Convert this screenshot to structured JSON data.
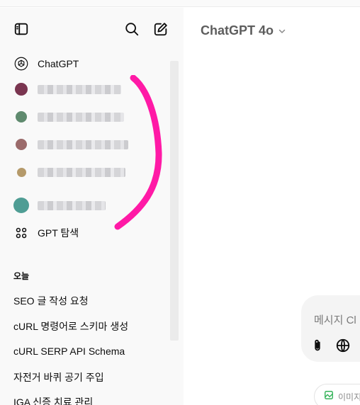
{
  "sidebar": {
    "gpts": [
      {
        "label": "ChatGPT",
        "icon": "openai-logo-icon",
        "blurred": false
      },
      {
        "label": "",
        "icon": "gpt-avatar-1",
        "blurred": true,
        "avatar_color": "#7a3550"
      },
      {
        "label": "",
        "icon": "gpt-avatar-2",
        "blurred": true,
        "avatar_color": "#5f8a6e"
      },
      {
        "label": "",
        "icon": "gpt-avatar-3",
        "blurred": true,
        "avatar_color": "#9b6b6b"
      },
      {
        "label": "",
        "icon": "gpt-avatar-4",
        "blurred": true,
        "avatar_color": "#b59a6a"
      },
      {
        "label": "",
        "icon": "gpt-avatar-5",
        "blurred": true,
        "avatar_color": "#4f9d94"
      }
    ],
    "explore_label": "GPT 탐색",
    "section_today": "오늘",
    "history": [
      "SEO 글 작성 요청",
      "cURL 명령어로 스키마 생성",
      "cURL SERP API Schema",
      "자전거 바퀴 공기 주입",
      "IGA 신증 치료 관리"
    ]
  },
  "main": {
    "model_name": "ChatGPT 4o",
    "composer_placeholder": "메시지 Cl",
    "chip_label": "이미지"
  },
  "colors": {
    "annotation": "#ff1aa6",
    "sidebar_bg": "#f9f9f9",
    "composer_bg": "#f4f4f4"
  }
}
